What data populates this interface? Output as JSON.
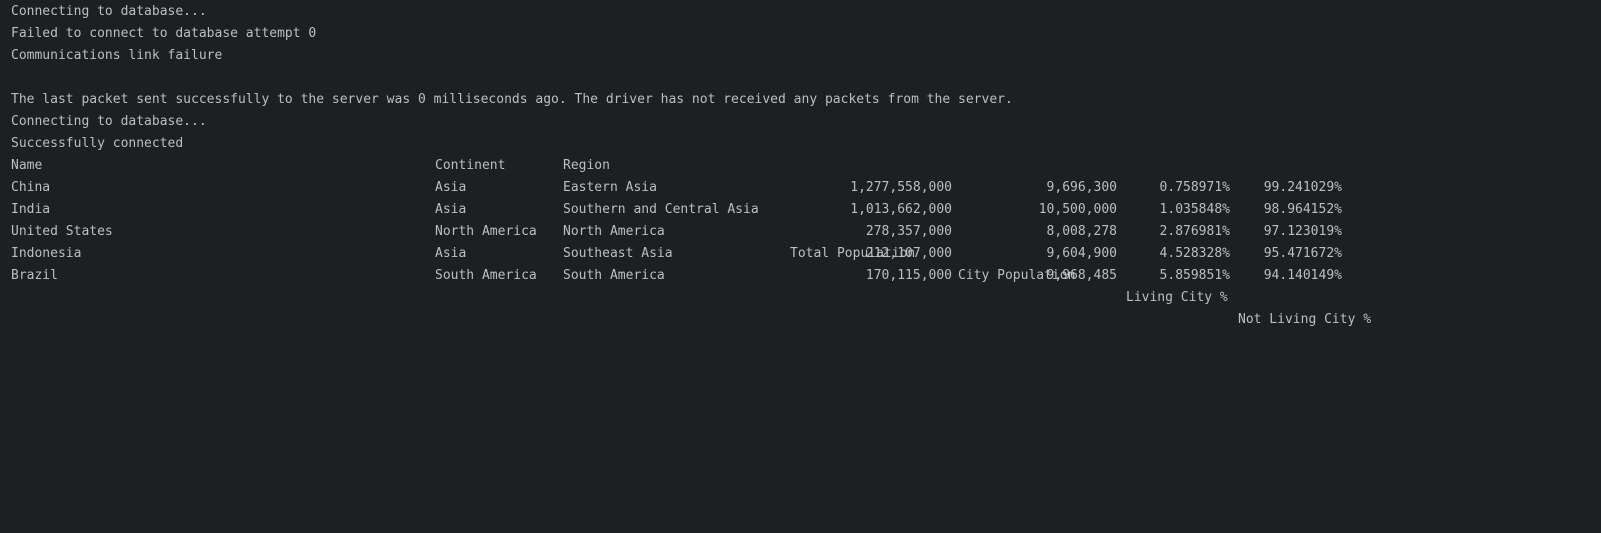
{
  "log": {
    "line1": "Connecting to database...",
    "line2": "Failed to connect to database attempt 0",
    "line3": "Communications link failure",
    "line4": "",
    "line5": "The last packet sent successfully to the server was 0 milliseconds ago. The driver has not received any packets from the server.",
    "line6": "Connecting to database...",
    "line7": "Successfully connected"
  },
  "table": {
    "headers": {
      "name": "Name",
      "continent": "Continent",
      "region": "Region",
      "total_population": "Total Population",
      "city_population": "City Population",
      "living_city": "Living City %",
      "not_living_city": "Not Living City %"
    },
    "rows": [
      {
        "name": "China",
        "continent": "Asia",
        "region": "Eastern Asia",
        "total_population": "1,277,558,000",
        "city_population": "9,696,300",
        "living_city": "0.758971%",
        "not_living_city": "99.241029%"
      },
      {
        "name": "India",
        "continent": "Asia",
        "region": "Southern and Central Asia",
        "total_population": "1,013,662,000",
        "city_population": "10,500,000",
        "living_city": "1.035848%",
        "not_living_city": "98.964152%"
      },
      {
        "name": "United States",
        "continent": "North America",
        "region": "North America",
        "total_population": "278,357,000",
        "city_population": "8,008,278",
        "living_city": "2.876981%",
        "not_living_city": "97.123019%"
      },
      {
        "name": "Indonesia",
        "continent": "Asia",
        "region": "Southeast Asia",
        "total_population": "212,107,000",
        "city_population": "9,604,900",
        "living_city": "4.528328%",
        "not_living_city": "95.471672%"
      },
      {
        "name": "Brazil",
        "continent": "South America",
        "region": "South America",
        "total_population": "170,115,000",
        "city_population": "9,968,485",
        "living_city": "5.859851%",
        "not_living_city": "94.140149%"
      }
    ]
  }
}
